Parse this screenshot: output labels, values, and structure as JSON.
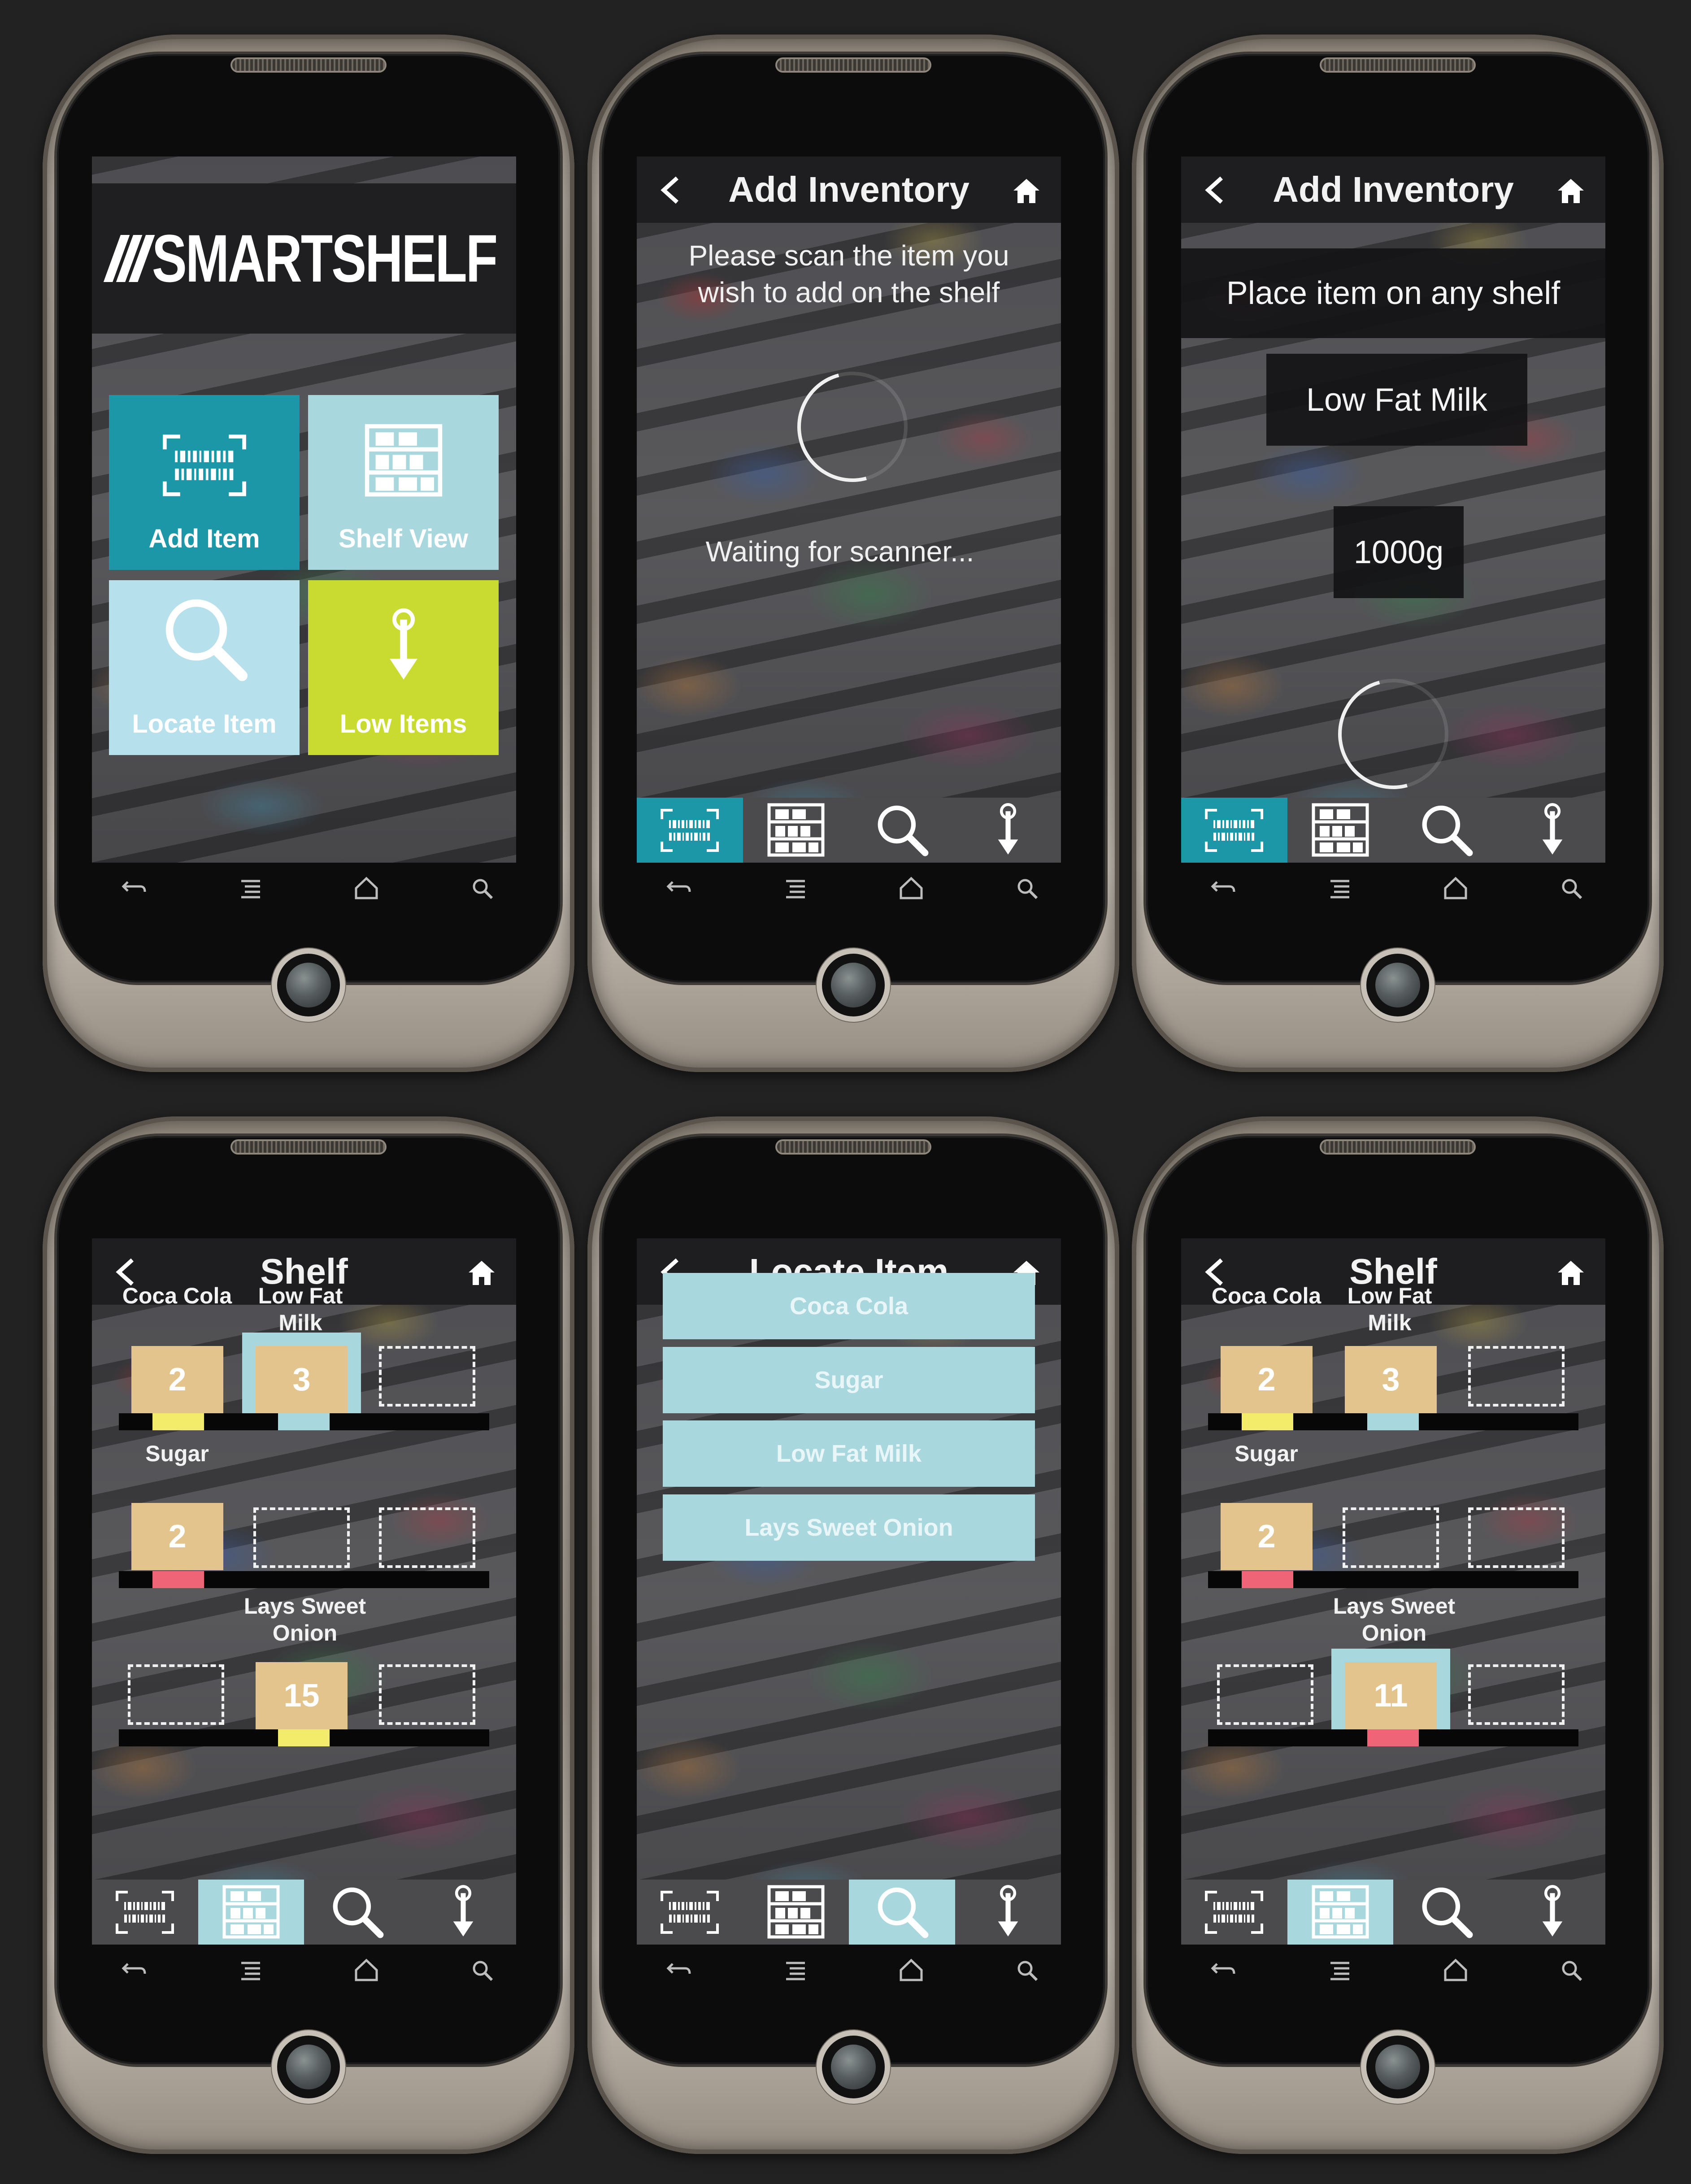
{
  "colors": {
    "teal": "#1b97a8",
    "light_blue": "#a9d7de",
    "pale_blue": "#b6e1ec",
    "lime": "#c9db31",
    "tan": "#e2c48c",
    "yellow": "#f3ec6a",
    "pink": "#f06478"
  },
  "home": {
    "logo": "SMARTSHELF",
    "tiles": [
      {
        "label": "Add Item",
        "icon": "barcode-icon"
      },
      {
        "label": "Shelf View",
        "icon": "shelf-icon"
      },
      {
        "label": "Locate Item",
        "icon": "search-icon"
      },
      {
        "label": "Low Items",
        "icon": "thermometer-down-icon"
      }
    ]
  },
  "scan_screen": {
    "title": "Add Inventory",
    "prompt_line1": "Please scan the item you",
    "prompt_line2": "wish to add on the shelf",
    "status": "Waiting for scanner..."
  },
  "place_screen": {
    "title": "Add Inventory",
    "instruction": "Place item on any shelf",
    "item_name": "Low Fat Milk",
    "weight": "1000g"
  },
  "shelf_screen_a": {
    "title": "Shelf",
    "rows": [
      {
        "labels": [
          "Coca Cola",
          "Low Fat Milk",
          ""
        ],
        "counts": [
          "2",
          "3",
          ""
        ]
      },
      {
        "labels": [
          "Sugar",
          "",
          ""
        ],
        "counts": [
          "2",
          "",
          ""
        ]
      },
      {
        "labels": [
          "",
          "Lays Sweet Onion",
          ""
        ],
        "counts": [
          "",
          "15",
          ""
        ]
      }
    ]
  },
  "locate_screen": {
    "title": "Locate Item",
    "items": [
      "Coca Cola",
      "Sugar",
      "Low Fat Milk",
      "Lays Sweet Onion"
    ]
  },
  "shelf_screen_b": {
    "title": "Shelf",
    "rows": [
      {
        "labels": [
          "Coca Cola",
          "Low Fat Milk",
          ""
        ],
        "counts": [
          "2",
          "3",
          ""
        ]
      },
      {
        "labels": [
          "Sugar",
          "",
          ""
        ],
        "counts": [
          "2",
          "",
          ""
        ]
      },
      {
        "labels": [
          "",
          "Lays Sweet Onion",
          ""
        ],
        "counts": [
          "",
          "11",
          ""
        ]
      }
    ]
  },
  "nav_icons": [
    "barcode-icon",
    "shelf-icon",
    "search-icon",
    "thermometer-down-icon"
  ],
  "softkeys": [
    "back-icon",
    "menu-icon",
    "home-icon",
    "search-icon"
  ]
}
